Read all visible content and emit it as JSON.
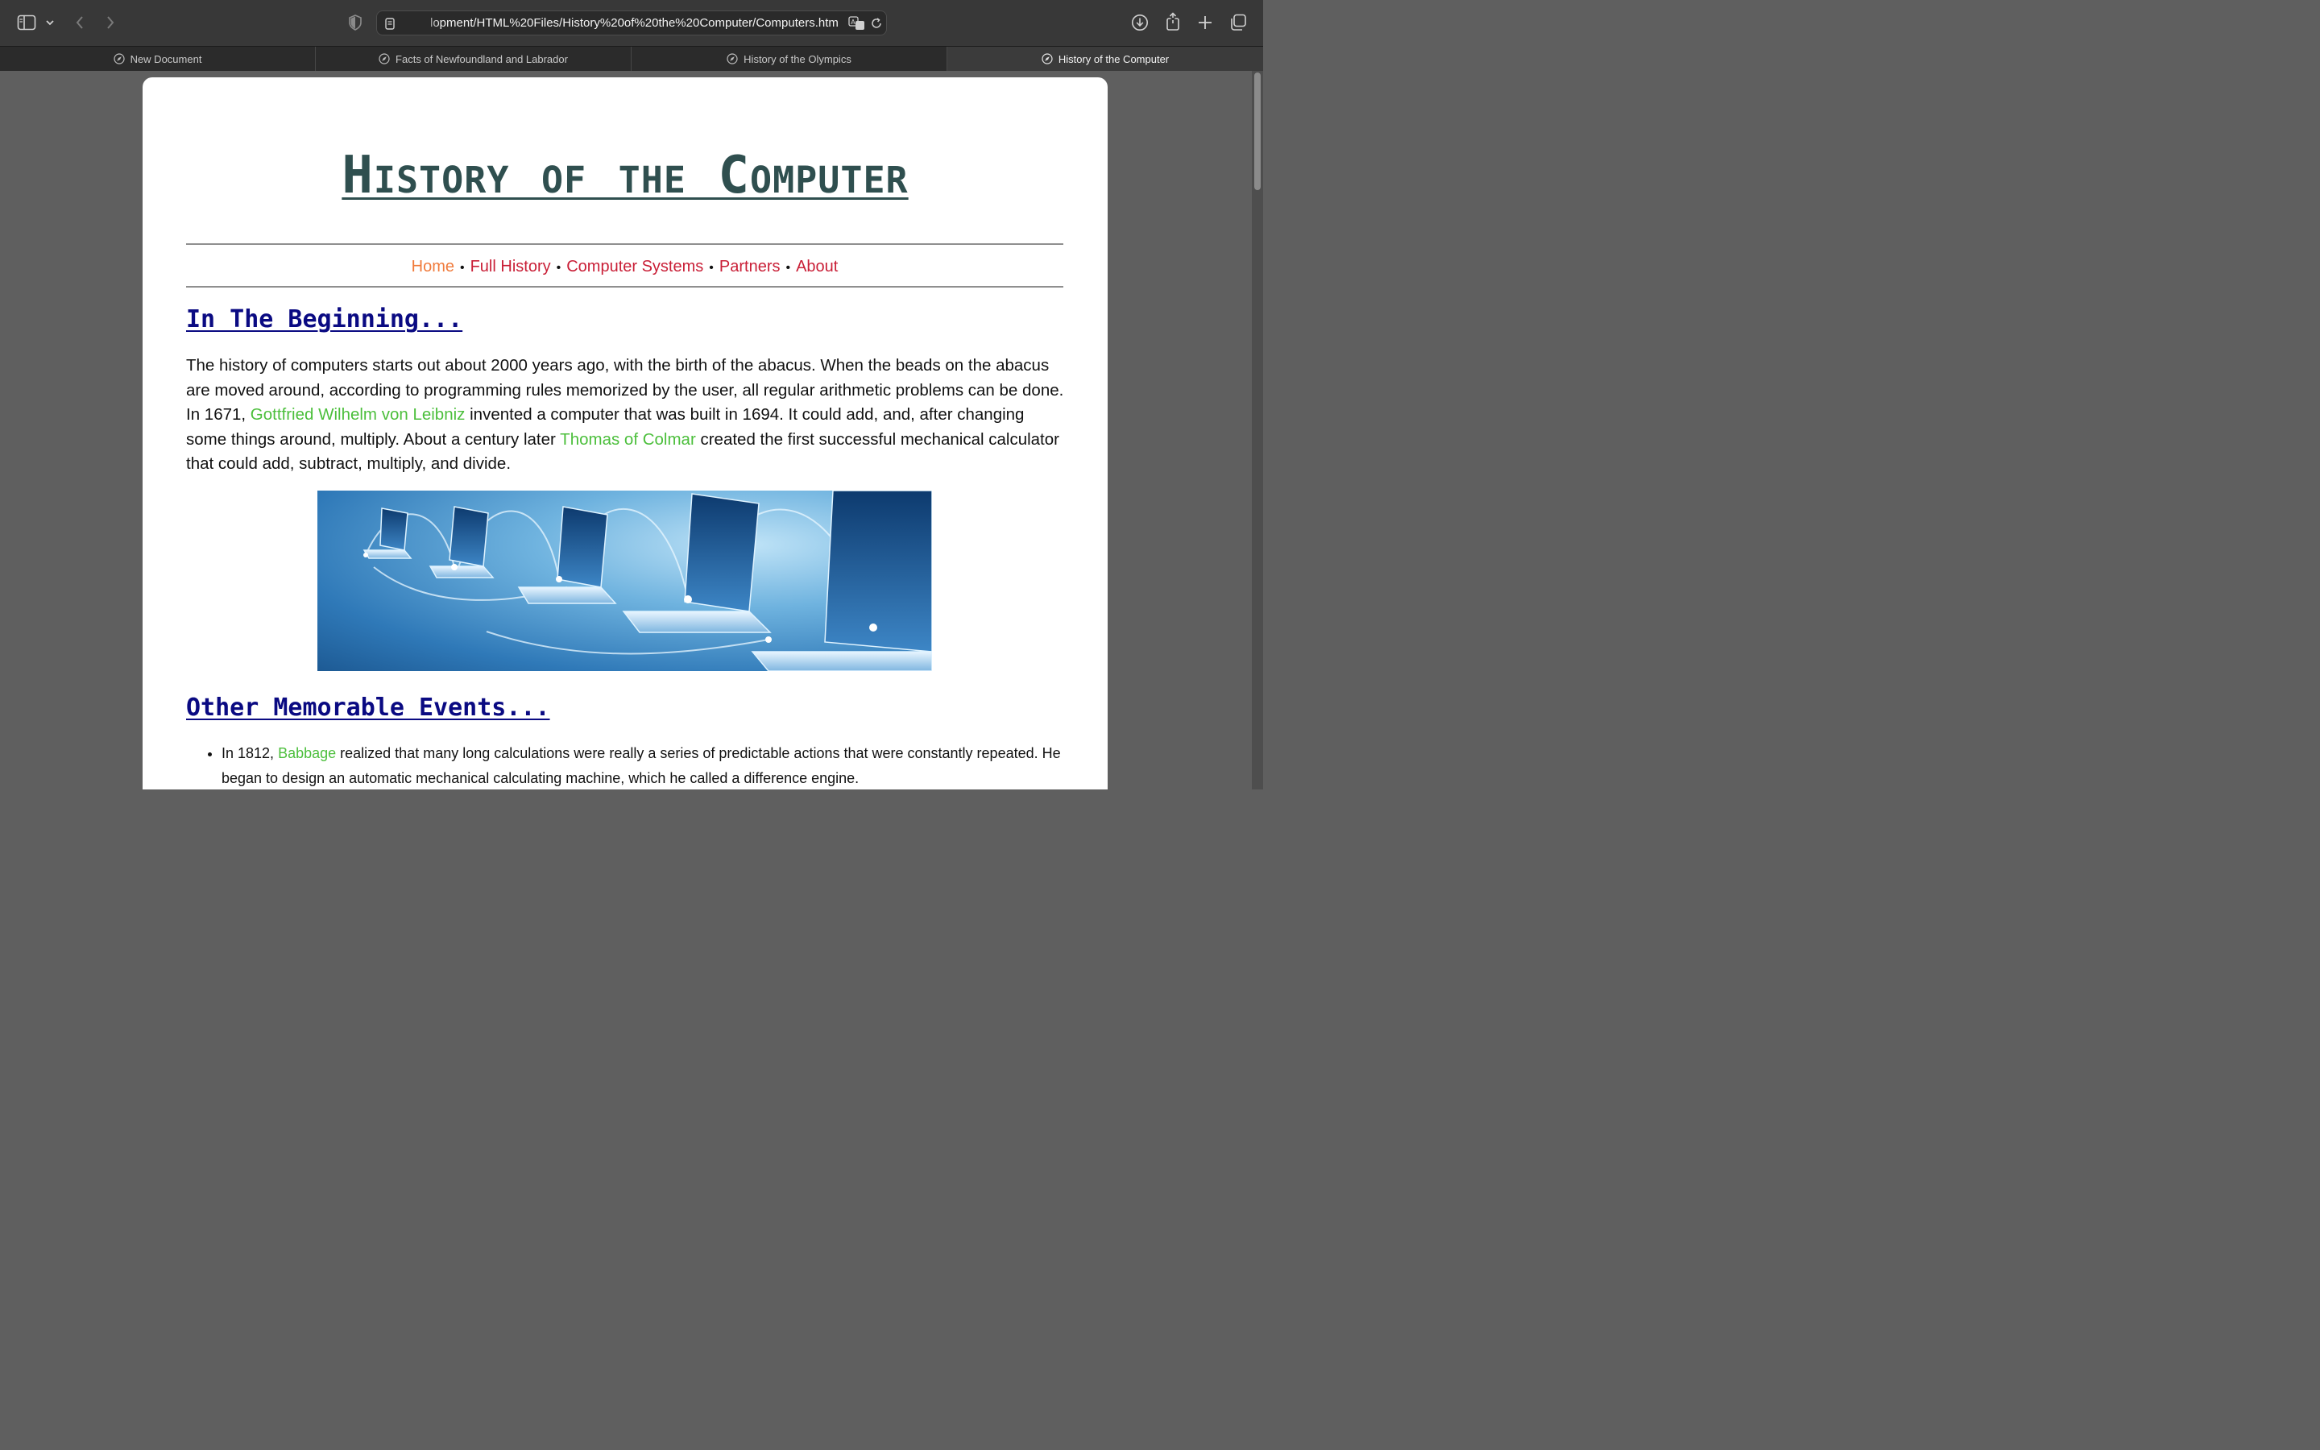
{
  "browser": {
    "url": "lopment/HTML%20Files/History%20of%20the%20Computer/Computers.html",
    "tabs": [
      {
        "label": "New Document",
        "active": false
      },
      {
        "label": "Facts of Newfoundland and Labrador",
        "active": false
      },
      {
        "label": "History of the Olympics",
        "active": false
      },
      {
        "label": "History of the Computer",
        "active": true
      }
    ]
  },
  "page": {
    "title": "History of the Computer",
    "nav": {
      "home": "Home",
      "full_history": "Full History",
      "computer_systems": "Computer Systems",
      "partners": "Partners",
      "about": "About",
      "separator": "•"
    },
    "section1": {
      "heading": "In The Beginning...",
      "p1": "The history of computers starts out about 2000 years ago, with the birth of the abacus. When the beads on the abacus are moved around, according to programming rules memorized by the user, all regular arithmetic problems can be done. In 1671, ",
      "link1": "Gottfried Wilhelm von Leibniz",
      "p2": " invented a computer that was built in 1694. It could add, and, after changing some things around, multiply. About a century later ",
      "link2": "Thomas of Colmar",
      "p3": " created the first successful mechanical calculator that could add, subtract, multiply, and divide."
    },
    "section2": {
      "heading": "Other Memorable Events...",
      "bullet1_pre": "In 1812, ",
      "bullet1_link": "Babbage",
      "bullet1_post": " realized that many long calculations were really a series of predictable actions that were constantly repeated. He began to design an automatic mechanical calculating machine, which he called a difference engine."
    }
  },
  "colors": {
    "title": "#2f4f4f",
    "nav_current": "#f07b3c",
    "nav_link": "#c91f37",
    "heading": "#0a0a82",
    "inline_link": "#4cbf3c"
  }
}
